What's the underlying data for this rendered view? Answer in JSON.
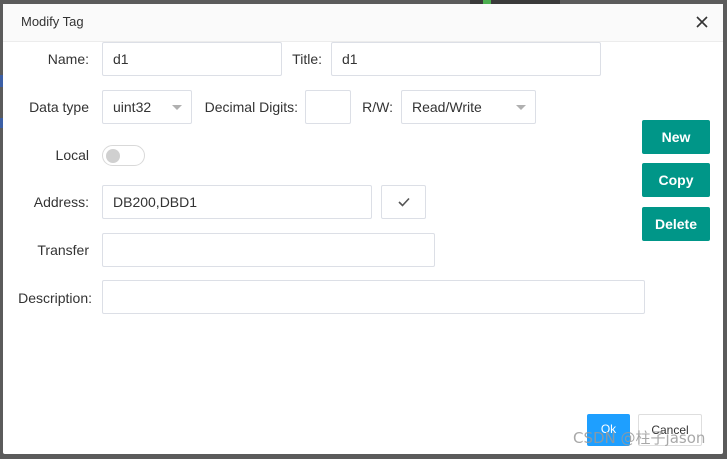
{
  "dialog": {
    "title": "Modify Tag",
    "close_icon": "close-icon"
  },
  "form": {
    "name_label": "Name:",
    "name_value": "d1",
    "title_label": "Title:",
    "title_value": "d1",
    "datatype_label": "Data type",
    "datatype_value": "uint32",
    "decimal_label": "Decimal Digits:",
    "decimal_value": "",
    "rw_label": "R/W:",
    "rw_value": "Read/Write",
    "local_label": "Local",
    "local_on": false,
    "address_label": "Address:",
    "address_value": "DB200,DBD1",
    "verify_icon": "check-icon",
    "transfer_label": "Transfer",
    "transfer_value": "",
    "description_label": "Description:",
    "description_value": ""
  },
  "side_actions": {
    "new_label": "New",
    "copy_label": "Copy",
    "delete_label": "Delete"
  },
  "footer": {
    "ok_label": "Ok",
    "cancel_label": "Cancel"
  },
  "watermark": "CSDN @柱子jason",
  "colors": {
    "primary": "#009688",
    "ok": "#1e9fff"
  }
}
